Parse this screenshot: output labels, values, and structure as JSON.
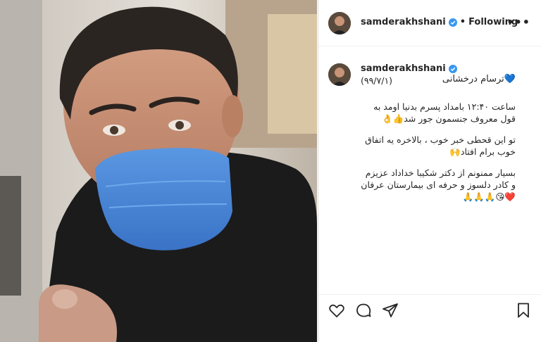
{
  "post": {
    "username": "samderakhshani",
    "follow_status": "Following",
    "separator": "•",
    "more_label": "•••"
  },
  "caption": {
    "username": "samderakhshani",
    "first_line": "💙ترسام درخشانی",
    "date_line": "(۹۹/۷/۱)",
    "paragraph1": "ساعت ۱۲:۴۰ بامداد پسرم بدنیا اومد به قول معروف جنسمون جور شد👍👌",
    "paragraph2": "تو این قحطی خبر خوب ، بالاخره یه اتفاق خوب برام افتاد🙌",
    "paragraph3": "بسیار ممنونم از دکتر شکیبا خداداد عزیزم و کادر دلسوز و حرفه ای بیمارستان عرفان ❤️😘🙏🙏🙏"
  },
  "icons": {
    "verified": "verified-badge-icon",
    "like": "heart-icon",
    "comment": "comment-icon",
    "share": "paper-plane-icon",
    "save": "bookmark-icon"
  },
  "colors": {
    "verified_blue": "#3897f0",
    "text": "#262626",
    "border": "#dbdbdb",
    "mask_blue": "#4a86d6"
  }
}
